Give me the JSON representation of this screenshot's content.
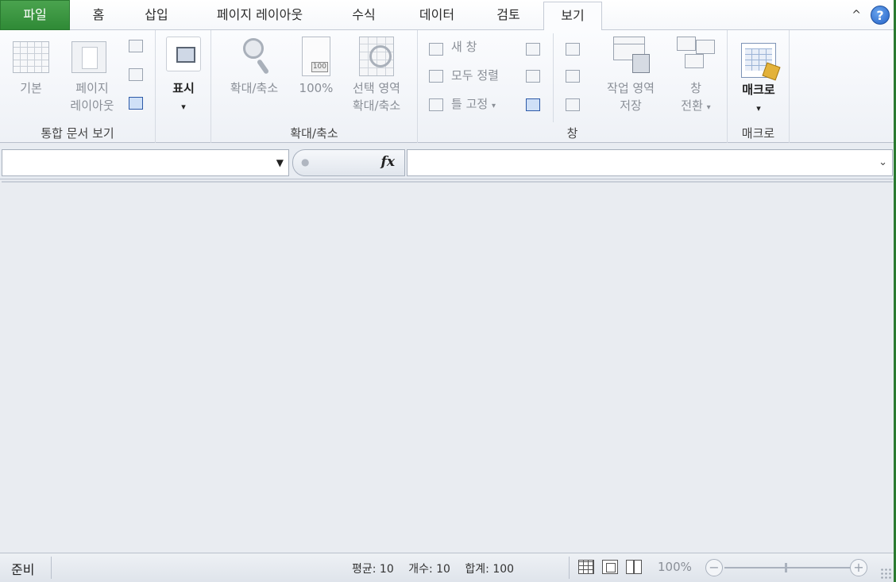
{
  "tabs": [
    {
      "label": "파일"
    },
    {
      "label": "홈"
    },
    {
      "label": "삽입"
    },
    {
      "label": "페이지 레이아웃"
    },
    {
      "label": "수식"
    },
    {
      "label": "데이터"
    },
    {
      "label": "검토"
    },
    {
      "label": "보기"
    }
  ],
  "strip": {
    "help_glyph": "?",
    "collapse_glyph": "^"
  },
  "ribbon": {
    "workbook_views": {
      "label": "통합 문서 보기",
      "normal": "기본",
      "page_layout_line1": "페이지",
      "page_layout_line2": "레이아웃"
    },
    "show": {
      "label": "표시",
      "arrow": "▾"
    },
    "zoom": {
      "label": "확대/축소",
      "zoom_btn": "확대/축소",
      "hundred": "100%",
      "hundred_badge": "100",
      "zoom_sel_line1": "선택 영역",
      "zoom_sel_line2": "확대/축소"
    },
    "window": {
      "label": "창",
      "new_window": "새 창",
      "arrange_all": "모두 정렬",
      "freeze_panes": "틀 고정",
      "freeze_arrow": "▾",
      "save_ws_line1": "작업 영역",
      "save_ws_line2": "저장",
      "switch_line1": "창",
      "switch_line2": "전환",
      "switch_arrow": "▾"
    },
    "macros": {
      "label": "매크로",
      "button": "매크로",
      "arrow": "▾"
    }
  },
  "formula_bar": {
    "name_value": "",
    "formula_value": "",
    "fx": "fx",
    "dropdown": "▼",
    "expand": "⌄"
  },
  "status": {
    "ready": "준비",
    "average": "평균: 10",
    "count": "개수: 10",
    "sum": "합계: 100",
    "zoom": "100%",
    "zoom_minus": "−",
    "zoom_plus": "+"
  },
  "colors": {
    "file_tab": "#2f8a36",
    "accent": "#2563c7"
  }
}
